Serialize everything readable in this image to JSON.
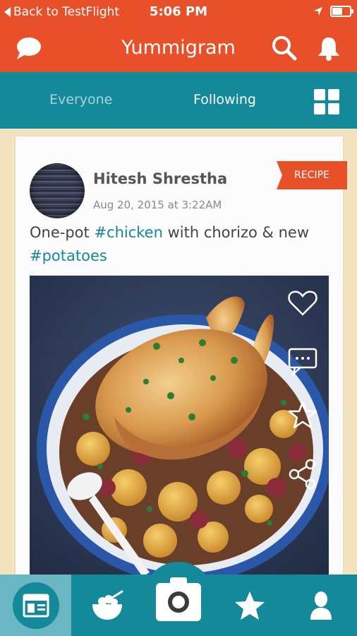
{
  "status_bar": {
    "back_label": "Back to TestFlight",
    "time": "5:06 PM"
  },
  "header": {
    "title": "Yummigram"
  },
  "tabs": {
    "items": [
      {
        "label": "Everyone"
      },
      {
        "label": "Following"
      }
    ]
  },
  "post": {
    "author": "Hitesh Shrestha",
    "date": "Aug 20, 2015 at 3:22AM",
    "badge": "RECIPE",
    "caption": {
      "part1": "One-pot ",
      "tag1": "#chicken",
      "part2": " with chorizo & new",
      "tag2": "#potatoes"
    }
  },
  "icons": {
    "header_left": "chat-bubble-icon",
    "header_right": [
      "search-icon",
      "bell-icon"
    ],
    "tab_right": "grid-icon",
    "post_actions": [
      "heart-icon",
      "comment-icon",
      "star-icon",
      "share-icon"
    ],
    "bottom_nav": [
      "feed-icon",
      "bowl-icon",
      "camera-icon",
      "star-icon",
      "profile-icon"
    ]
  },
  "colors": {
    "header": "#e8502a",
    "teal": "#14899a",
    "background": "#f3e4bf"
  }
}
